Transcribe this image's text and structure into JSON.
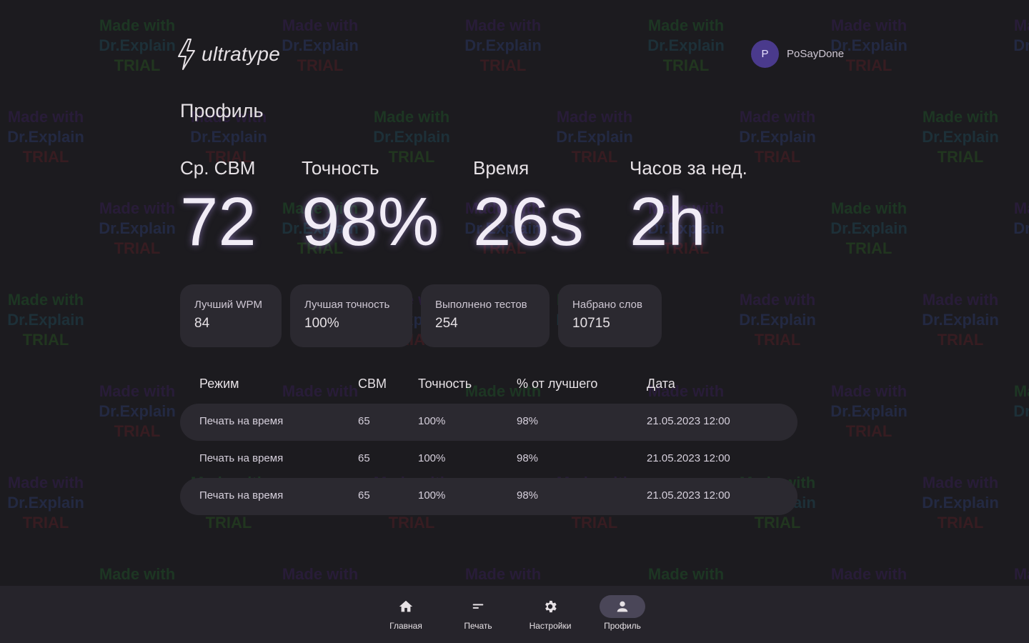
{
  "watermark": {
    "line1": "Made with",
    "line2": "Dr.Explain",
    "line3": "TRIAL"
  },
  "header": {
    "logo_text": "ultratype"
  },
  "user": {
    "avatar_letter": "P",
    "name": "PoSayDone"
  },
  "page": {
    "title": "Профиль"
  },
  "stats": [
    {
      "label": "Ср. СВМ",
      "value": "72"
    },
    {
      "label": "Точность",
      "value": "98%"
    },
    {
      "label": "Время",
      "value": "26s"
    },
    {
      "label": "Часов за нед.",
      "value": "2h"
    }
  ],
  "cards": [
    {
      "label": "Лучший WPM",
      "value": "84"
    },
    {
      "label": "Лучшая точность",
      "value": "100%"
    },
    {
      "label": "Выполнено тестов",
      "value": "254"
    },
    {
      "label": "Набрано слов",
      "value": "10715"
    }
  ],
  "history": {
    "columns": [
      "Режим",
      "СВМ",
      "Точность",
      "% от лучшего",
      "Дата"
    ],
    "rows": [
      [
        "Печать на время",
        "65",
        "100%",
        "98%",
        "21.05.2023 12:00"
      ],
      [
        "Печать на время",
        "65",
        "100%",
        "98%",
        "21.05.2023 12:00"
      ],
      [
        "Печать на время",
        "65",
        "100%",
        "98%",
        "21.05.2023 12:00"
      ]
    ]
  },
  "nav": {
    "items": [
      {
        "label": "Главная",
        "icon": "home-icon"
      },
      {
        "label": "Печать",
        "icon": "text-lines-icon"
      },
      {
        "label": "Настройки",
        "icon": "gear-icon"
      },
      {
        "label": "Профиль",
        "icon": "person-icon"
      }
    ],
    "active": "Профиль"
  },
  "colors": {
    "background": "#1c1b1f",
    "surface": "#2b2930",
    "avatar": "#4a3a8c",
    "nav_active_pill": "#4a4658"
  }
}
